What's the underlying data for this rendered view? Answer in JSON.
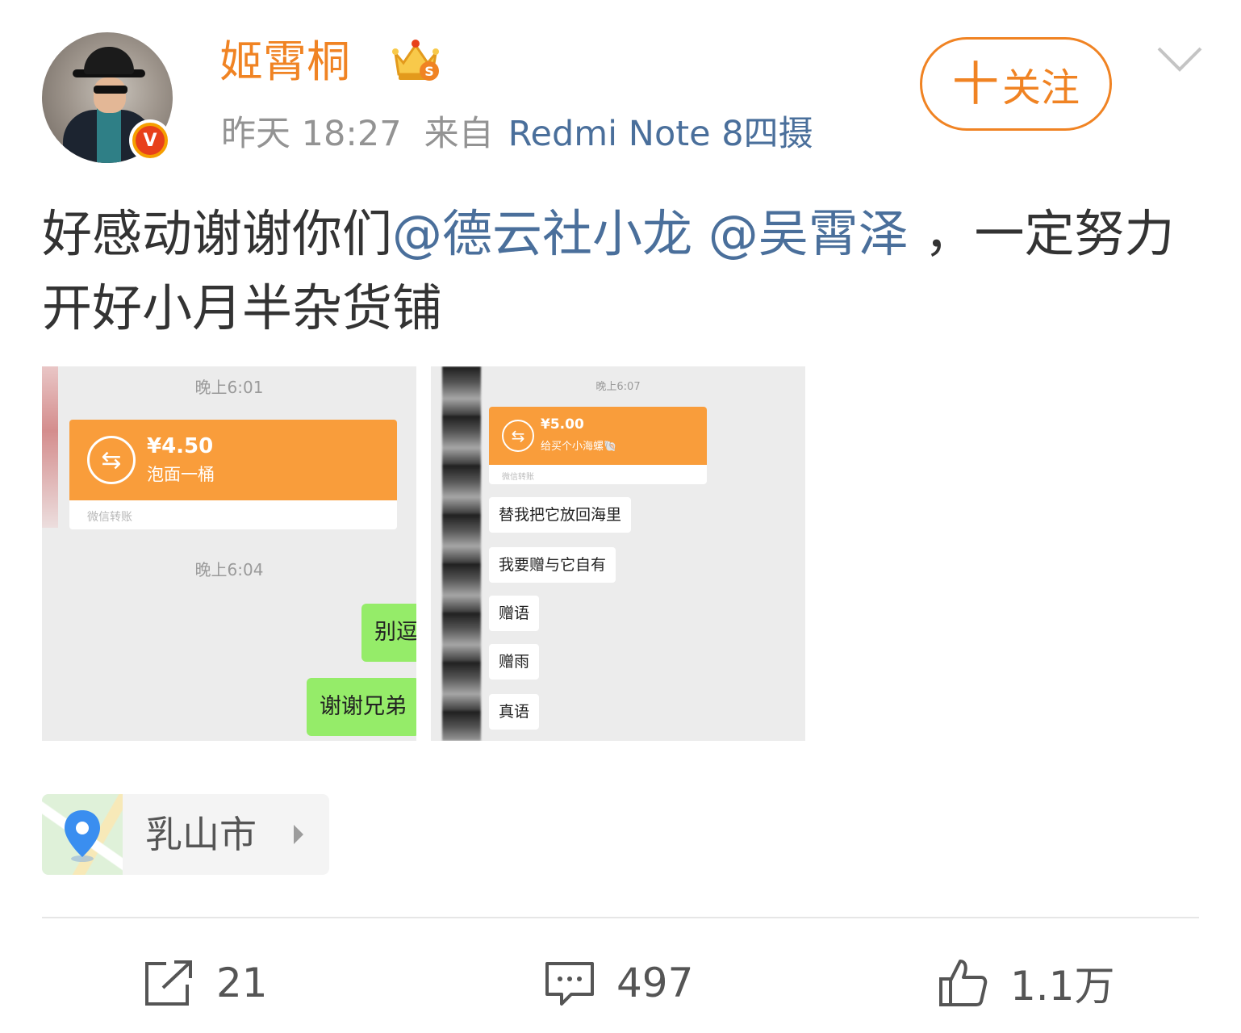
{
  "post": {
    "username": "姬霄桐",
    "time": "昨天 18:27",
    "from_label": "来自",
    "device": "Redmi Note 8四摄",
    "follow_label": "关注",
    "follow_plus": "十",
    "text_prefix": "好感动谢谢你们",
    "mention1": "@德云社小龙",
    "mention2": "@吴霄泽",
    "text_suffix": "，一定努力开好小月半杂货铺",
    "badge_letter": "V"
  },
  "image1": {
    "time1": "晚上6:01",
    "amount": "¥4.50",
    "note": "泡面一桶",
    "footer": "微信转账",
    "time2": "晚上6:04",
    "msg1": "别逗",
    "msg2": "谢谢兄弟"
  },
  "image2": {
    "time1": "晚上6:07",
    "amount": "¥5.00",
    "note": "给买个小海螺🐚",
    "footer": "微信转账",
    "msg1": "替我把它放回海里",
    "msg2": "我要赠与它自有",
    "msg3": "赠语",
    "msg4": "赠雨",
    "msg5": "真语"
  },
  "location": {
    "name": "乳山市"
  },
  "actions": {
    "repost_count": "21",
    "comment_count": "497",
    "like_count": "1.1万"
  },
  "colors": {
    "accent": "#f08323",
    "link": "#4a6f9b",
    "meta": "#939393",
    "wechat_orange": "#f99d3b",
    "wechat_green": "#95ec69"
  }
}
